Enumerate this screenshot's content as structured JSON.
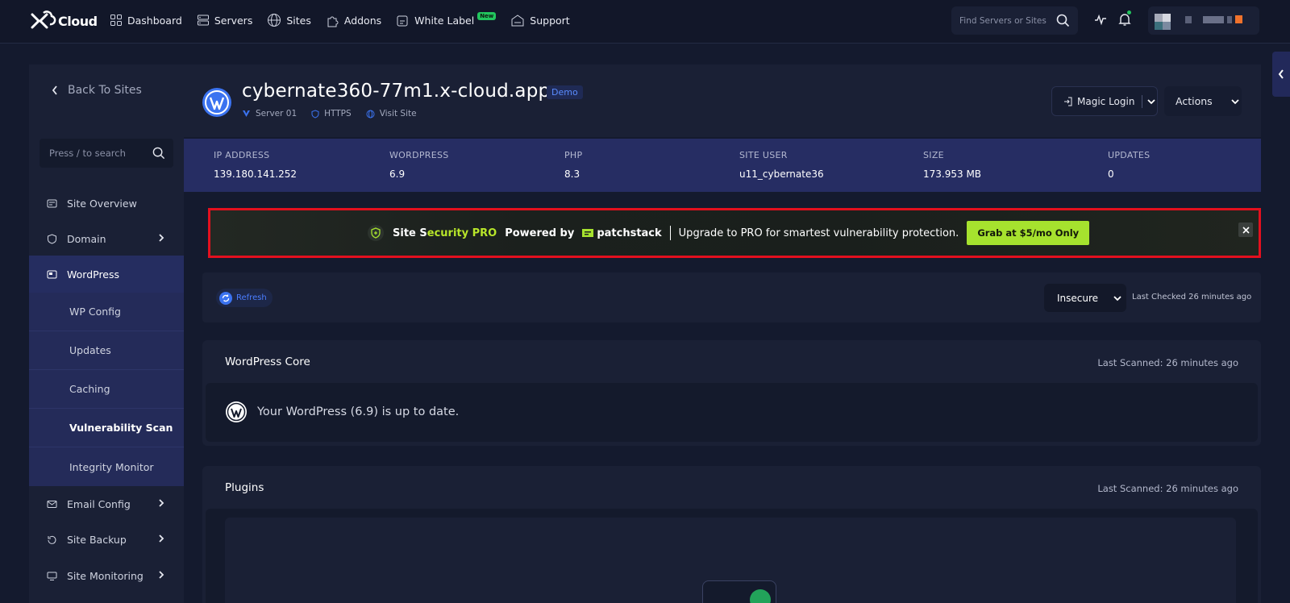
{
  "brand": {
    "logo_text": "Cloud"
  },
  "nav": {
    "items": [
      {
        "label": "Dashboard",
        "icon": "dashboard-icon"
      },
      {
        "label": "Servers",
        "icon": "server-icon"
      },
      {
        "label": "Sites",
        "icon": "globe-icon"
      },
      {
        "label": "Addons",
        "icon": "puzzle-icon"
      },
      {
        "label": "White Label",
        "icon": "white-label-icon"
      },
      {
        "label": "Support",
        "icon": "support-icon"
      }
    ],
    "new_badge": "New",
    "search_placeholder": "Find Servers or Sites"
  },
  "sidebar": {
    "back_label": "Back To Sites",
    "search_placeholder": "Press / to search",
    "items": [
      {
        "label": "Site Overview"
      },
      {
        "label": "Domain"
      },
      {
        "label": "WordPress"
      },
      {
        "label": "Email Config"
      },
      {
        "label": "Site Backup"
      },
      {
        "label": "Site Monitoring"
      }
    ],
    "sub_items": [
      {
        "label": "WP Config"
      },
      {
        "label": "Updates"
      },
      {
        "label": "Caching"
      },
      {
        "label": "Vulnerability Scan"
      },
      {
        "label": "Integrity Monitor"
      }
    ]
  },
  "site": {
    "title": "cybernate360-77m1.x-cloud.app",
    "badge": "Demo",
    "server": "Server 01",
    "https": "HTTPS",
    "visit": "Visit Site",
    "magic_login": "Magic Login",
    "actions": "Actions"
  },
  "stats": [
    {
      "label": "IP ADDRESS",
      "value": "139.180.141.252"
    },
    {
      "label": "WORDPRESS",
      "value": "6.9"
    },
    {
      "label": "PHP",
      "value": "8.3"
    },
    {
      "label": "SITE USER",
      "value": "u11_cybernate36"
    },
    {
      "label": "SIZE",
      "value": "173.953 MB"
    },
    {
      "label": "UPDATES",
      "value": "0"
    }
  ],
  "promo": {
    "site_s": "Site S",
    "ecurity_pro": "ecurity PRO",
    "powered_by": "Powered by",
    "brand": "patchstack",
    "message": "Upgrade to PRO for smartest vulnerability protection.",
    "cta": "Grab at $5/mo Only",
    "accent": "#a6e22e"
  },
  "toolbar": {
    "refresh": "Refresh",
    "status": "Insecure",
    "last_checked": "Last Checked 26 minutes ago"
  },
  "core": {
    "title": "WordPress Core",
    "last_scanned": "Last Scanned: 26 minutes ago",
    "message": "Your WordPress (6.9) is up to date."
  },
  "plugins": {
    "title": "Plugins",
    "last_scanned": "Last Scanned: 26 minutes ago"
  }
}
